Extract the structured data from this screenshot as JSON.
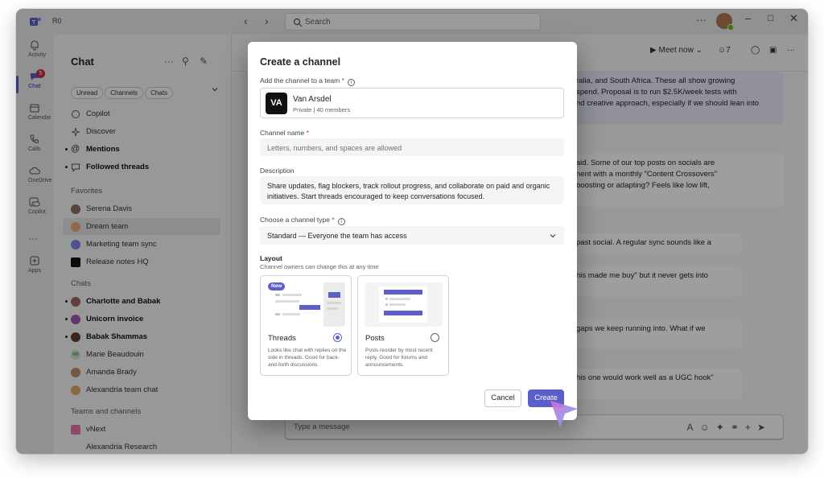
{
  "app": {
    "user_initials": "R0",
    "search_placeholder": "Search",
    "more_label": "···"
  },
  "rail": {
    "items": [
      {
        "label": "Activity",
        "icon": "bell-icon"
      },
      {
        "label": "Chat",
        "icon": "chat-icon",
        "badge": "5"
      },
      {
        "label": "Calendar",
        "icon": "calendar-icon"
      },
      {
        "label": "Calls",
        "icon": "phone-icon"
      },
      {
        "label": "OneDrive",
        "icon": "cloud-icon"
      },
      {
        "label": "Copilot",
        "icon": "copilot-icon"
      },
      {
        "label": "···",
        "icon": "more-icon"
      },
      {
        "label": "Apps",
        "icon": "apps-icon"
      }
    ]
  },
  "sidebar": {
    "title": "Chat",
    "filters": [
      "Unread",
      "Channels",
      "Chats"
    ],
    "top_items": [
      {
        "label": "Copilot"
      },
      {
        "label": "Discover"
      },
      {
        "label": "Mentions"
      },
      {
        "label": "Followed threads"
      }
    ],
    "favorites_header": "Favorites",
    "favorites": [
      {
        "label": "Serena Davis"
      },
      {
        "label": "Dream team"
      },
      {
        "label": "Marketing team sync"
      },
      {
        "label": "Release notes HQ"
      }
    ],
    "chats_header": "Chats",
    "chats": [
      {
        "label": "Charlotte and Babak"
      },
      {
        "label": "Unicorn invoice"
      },
      {
        "label": "Babak Shammas"
      },
      {
        "label": "Marie Beaudouin",
        "initials": "MB"
      },
      {
        "label": "Amanda Brady"
      },
      {
        "label": "Alexandria team chat"
      }
    ],
    "teams_header": "Teams and channels",
    "teams": [
      {
        "label": "vNext"
      },
      {
        "label": "Alexandria Research"
      }
    ]
  },
  "main": {
    "meet_label": "Meet now",
    "participants_count": "7",
    "bubbles": [
      "ralia, and South Africa. These all show growing\nspend. Proposal is to run $2.5K/week tests with\nnd creative approach, especially if we should lean into",
      "aid. Some of our top posts on socials are\nnent with a monthly \"Content Crossovers\"\n boosting or adapting? Feels like low lift,",
      "past social. A regular sync sounds like a",
      "his made me buy\" but it never gets into",
      "gaps we keep running into. What if we",
      "his one would work well as a UGC hook\""
    ],
    "composer_placeholder": "Type a message"
  },
  "dialog": {
    "title": "Create a channel",
    "team_label": "Add the channel to a team",
    "team": {
      "logo_text": "VA",
      "name": "Van Arsdel",
      "meta": "Private | 40 members"
    },
    "name_label": "Channel name",
    "name_placeholder": "Letters, numbers, and spaces are allowed",
    "description_label": "Description",
    "description_value": "Share updates, flag blockers, track rollout progress, and collaborate on paid and organic initiatives. Start threads encouraged to keep conversations focused.",
    "type_label": "Choose a channel type",
    "type_value": "Standard — Everyone the team has access",
    "layout_label": "Layout",
    "layout_sub": "Channel owners can change this at any time",
    "options": [
      {
        "name": "Threads",
        "tag": "New",
        "desc": "Looks like chat with replies on the side in threads. Good for back-and-forth discussions.",
        "selected": true
      },
      {
        "name": "Posts",
        "desc": "Posts reorder by most recent reply. Good for forums and announcements.",
        "selected": false
      }
    ],
    "cancel_label": "Cancel",
    "create_label": "Create"
  },
  "colors": {
    "accent": "#5b5fc7",
    "badge": "#c4314b"
  }
}
